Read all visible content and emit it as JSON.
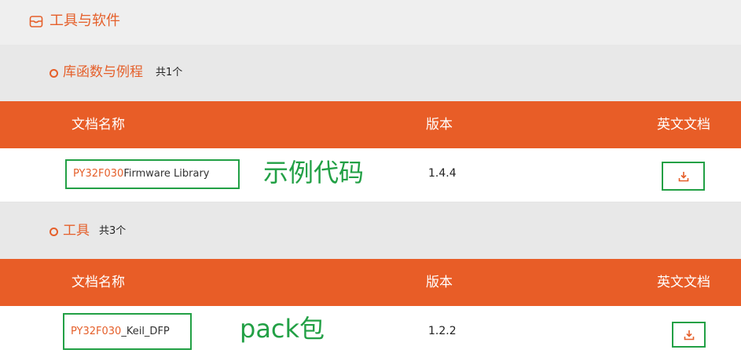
{
  "header": {
    "title": "工具与软件",
    "icon": "box-icon"
  },
  "sections": [
    {
      "title": "库函数与例程",
      "count": "共1个",
      "columns": [
        "文档名称",
        "版本",
        "英文文档"
      ],
      "rows": [
        {
          "name_prefix": "PY32F030",
          "name_rest": " Firmware Library",
          "version": "1.4.4",
          "annotation": "示例代码",
          "download_icon": "download-icon"
        }
      ]
    },
    {
      "title": "工具",
      "count": "共3个",
      "columns": [
        "文档名称",
        "版本",
        "英文文档"
      ],
      "rows": [
        {
          "name_prefix": "PY32F030",
          "name_rest": "_Keil_DFP",
          "version": "1.2.2",
          "annotation": "pack包",
          "download_icon": "download-icon"
        }
      ]
    }
  ],
  "colors": {
    "accent": "#e85d27",
    "highlight_border": "#22a045",
    "section_bg": "#e8e8e8"
  }
}
